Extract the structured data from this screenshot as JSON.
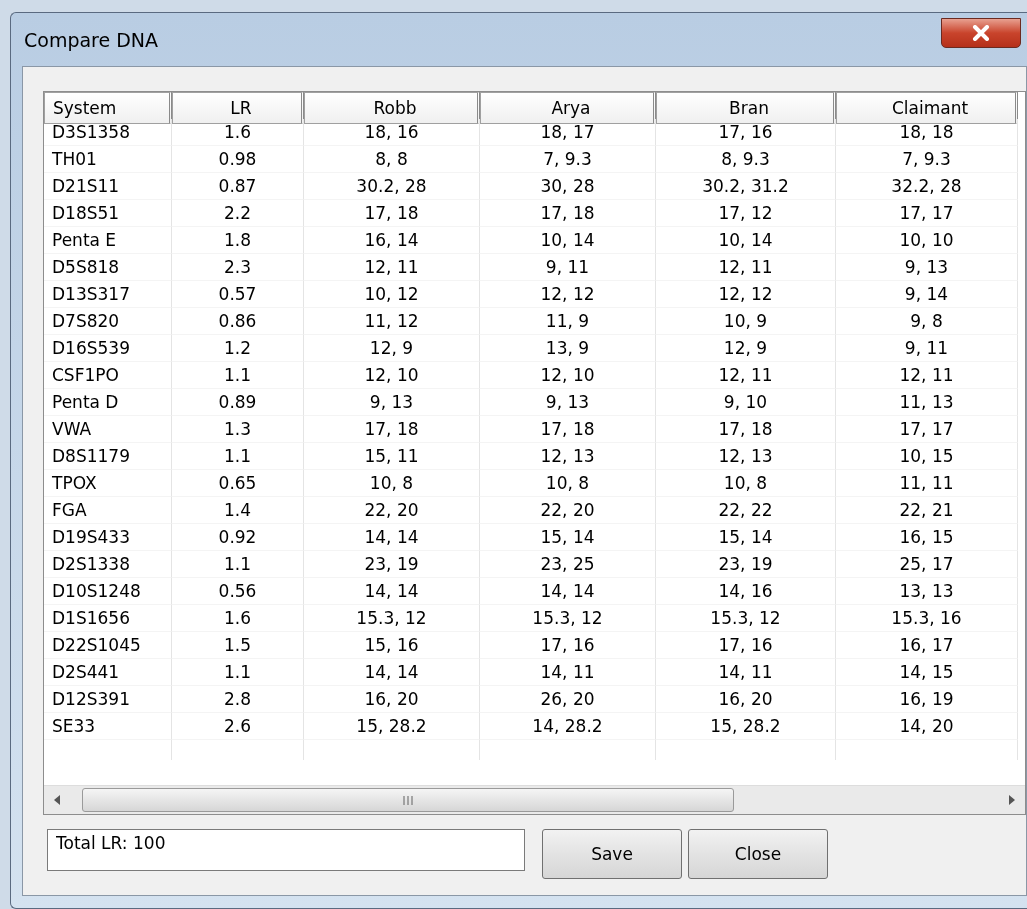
{
  "window": {
    "title": "Compare DNA"
  },
  "table": {
    "columns": [
      "System",
      "LR",
      "Robb",
      "Arya",
      "Bran",
      "Claimant"
    ],
    "rows": [
      [
        "D3S1358",
        "1.6",
        "18, 16",
        "18, 17",
        "17, 16",
        "18, 18"
      ],
      [
        "TH01",
        "0.98",
        "8, 8",
        "7, 9.3",
        "8, 9.3",
        "7, 9.3"
      ],
      [
        "D21S11",
        "0.87",
        "30.2, 28",
        "30, 28",
        "30.2, 31.2",
        "32.2, 28"
      ],
      [
        "D18S51",
        "2.2",
        "17, 18",
        "17, 18",
        "17, 12",
        "17, 17"
      ],
      [
        "Penta E",
        "1.8",
        "16, 14",
        "10, 14",
        "10, 14",
        "10, 10"
      ],
      [
        "D5S818",
        "2.3",
        "12, 11",
        "9, 11",
        "12, 11",
        "9, 13"
      ],
      [
        "D13S317",
        "0.57",
        "10, 12",
        "12, 12",
        "12, 12",
        "9, 14"
      ],
      [
        "D7S820",
        "0.86",
        "11, 12",
        "11, 9",
        "10, 9",
        "9, 8"
      ],
      [
        "D16S539",
        "1.2",
        "12, 9",
        "13, 9",
        "12, 9",
        "9, 11"
      ],
      [
        "CSF1PO",
        "1.1",
        "12, 10",
        "12, 10",
        "12, 11",
        "12, 11"
      ],
      [
        "Penta D",
        "0.89",
        "9, 13",
        "9, 13",
        "9, 10",
        "11, 13"
      ],
      [
        "VWA",
        "1.3",
        "17, 18",
        "17, 18",
        "17, 18",
        "17, 17"
      ],
      [
        "D8S1179",
        "1.1",
        "15, 11",
        "12, 13",
        "12, 13",
        "10, 15"
      ],
      [
        "TPOX",
        "0.65",
        "10, 8",
        "10, 8",
        "10, 8",
        "11, 11"
      ],
      [
        "FGA",
        "1.4",
        "22, 20",
        "22, 20",
        "22, 22",
        "22, 21"
      ],
      [
        "D19S433",
        "0.92",
        "14, 14",
        "15, 14",
        "15, 14",
        "16, 15"
      ],
      [
        "D2S1338",
        "1.1",
        "23, 19",
        "23, 25",
        "23, 19",
        "25, 17"
      ],
      [
        "D10S1248",
        "0.56",
        "14, 14",
        "14, 14",
        "14, 16",
        "13, 13"
      ],
      [
        "D1S1656",
        "1.6",
        "15.3, 12",
        "15.3, 12",
        "15.3, 12",
        "15.3, 16"
      ],
      [
        "D22S1045",
        "1.5",
        "15, 16",
        "17, 16",
        "17, 16",
        "16, 17"
      ],
      [
        "D2S441",
        "1.1",
        "14, 14",
        "14, 11",
        "14, 11",
        "14, 15"
      ],
      [
        "D12S391",
        "2.8",
        "16, 20",
        "26, 20",
        "16, 20",
        "16, 19"
      ],
      [
        "SE33",
        "2.6",
        "15, 28.2",
        "14, 28.2",
        "15, 28.2",
        "14, 20"
      ]
    ]
  },
  "total_field": {
    "value": "Total LR: 100"
  },
  "buttons": [
    "Save",
    "Close"
  ]
}
